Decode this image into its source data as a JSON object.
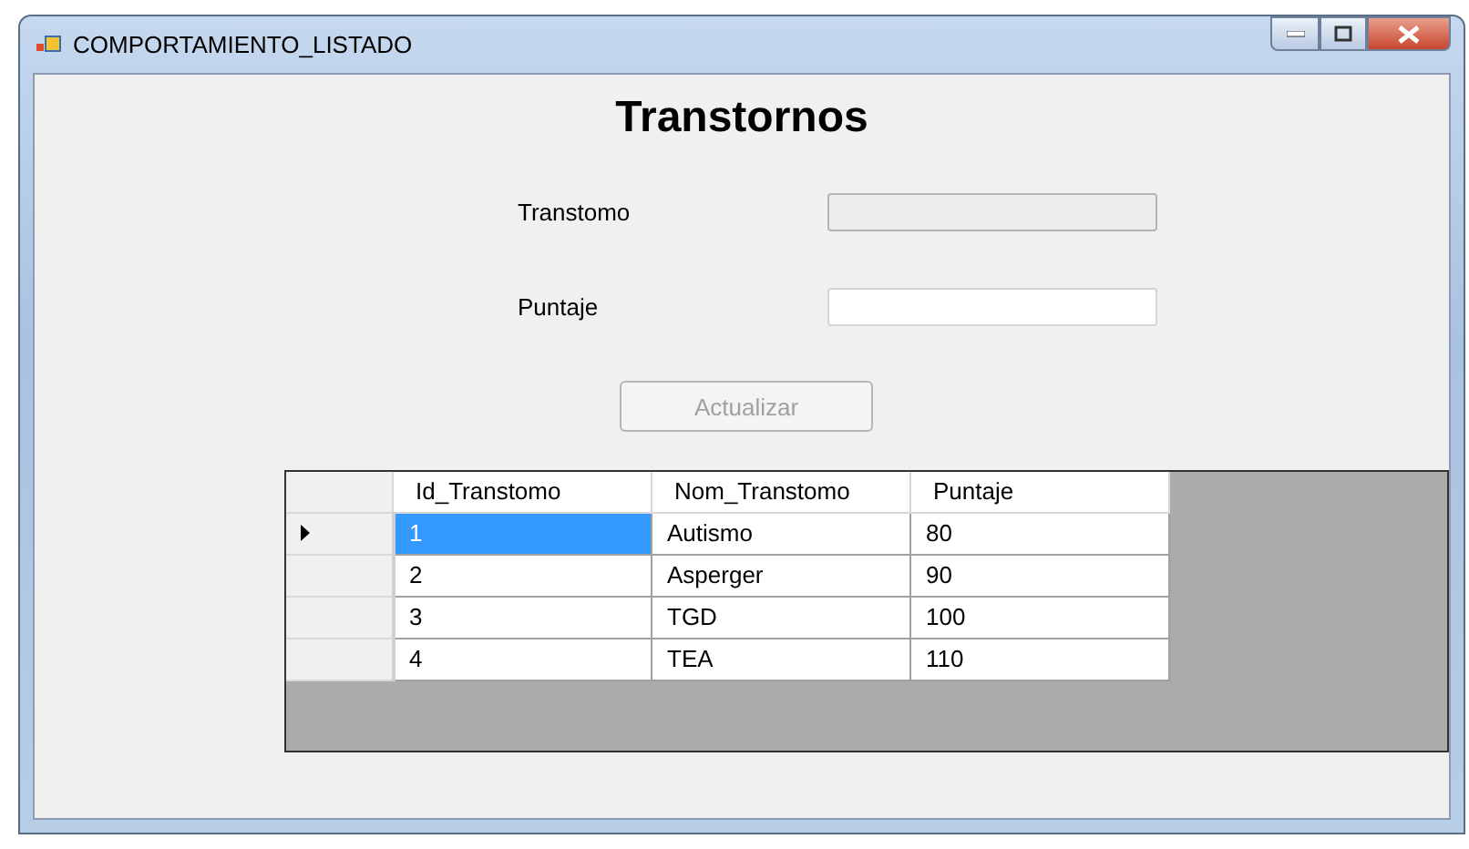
{
  "window": {
    "title": "COMPORTAMIENTO_LISTADO"
  },
  "heading": "Transtornos",
  "fields": [
    {
      "label": "Transtomo",
      "disabled": true
    },
    {
      "label": "Puntaje",
      "disabled": false
    }
  ],
  "button": {
    "label": "Actualizar",
    "disabled": true
  },
  "table": {
    "columns": [
      "Id_Transtomo",
      "Nom_Transtomo",
      "Puntaje"
    ],
    "rows": [
      {
        "cells": [
          "1",
          "Autismo",
          "80"
        ],
        "selected": true
      },
      {
        "cells": [
          "2",
          "Asperger",
          "90"
        ],
        "selected": false
      },
      {
        "cells": [
          "3",
          "TGD",
          "100"
        ],
        "selected": false
      },
      {
        "cells": [
          "4",
          "TEA",
          "110"
        ],
        "selected": false
      }
    ]
  }
}
